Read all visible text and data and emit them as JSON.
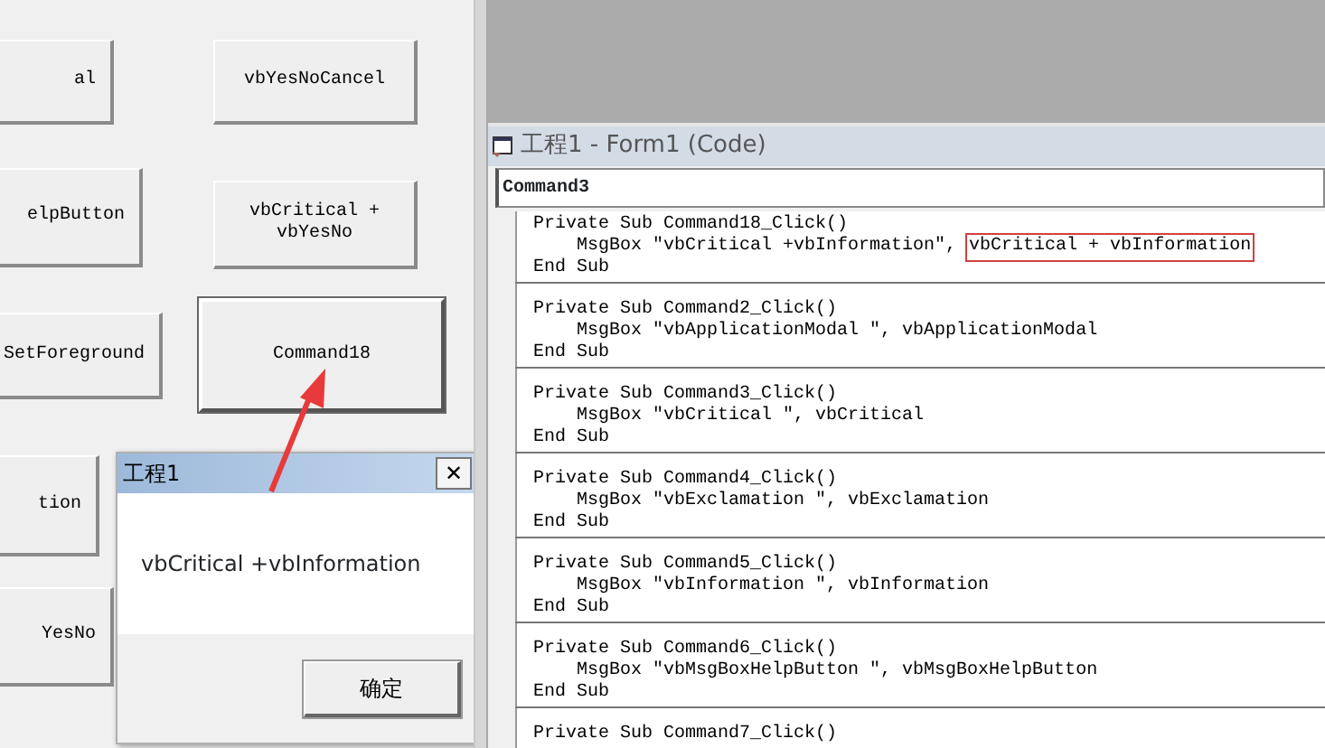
{
  "form_buttons": [
    {
      "label": "al",
      "selected": false
    },
    {
      "label": "vbYesNoCancel",
      "selected": false
    },
    {
      "label": "elpButton",
      "selected": false
    },
    {
      "label": "vbCritical +\nvbYesNo",
      "selected": false
    },
    {
      "label": "SetForeground",
      "selected": false
    },
    {
      "label": "Command18",
      "selected": true
    },
    {
      "label": "tion",
      "selected": false
    },
    {
      "label": "YesNo",
      "selected": false
    }
  ],
  "dialog": {
    "title": "工程1",
    "close": "✕",
    "message": "vbCritical +vbInformation",
    "button": "确定"
  },
  "code_window": {
    "title": "工程1 - Form1 (Code)",
    "object": "Command3",
    "procedures": [
      {
        "sub": "Private Sub Command18_Click()",
        "call": "    MsgBox \"vbCritical +vbInformation\", ",
        "arg": "vbCritical + vbInformation",
        "boxed": true,
        "end": "End Sub"
      },
      {
        "sub": "Private Sub Command2_Click()",
        "call": "    MsgBox \"vbApplicationModal \", ",
        "arg": "vbApplicationModal",
        "boxed": false,
        "end": "End Sub"
      },
      {
        "sub": "Private Sub Command3_Click()",
        "call": "    MsgBox \"vbCritical \", ",
        "arg": "vbCritical",
        "boxed": false,
        "end": "End Sub"
      },
      {
        "sub": "Private Sub Command4_Click()",
        "call": "    MsgBox \"vbExclamation \", ",
        "arg": "vbExclamation",
        "boxed": false,
        "end": "End Sub"
      },
      {
        "sub": "Private Sub Command5_Click()",
        "call": "    MsgBox \"vbInformation \", ",
        "arg": "vbInformation",
        "boxed": false,
        "end": "End Sub"
      },
      {
        "sub": "Private Sub Command6_Click()",
        "call": "    MsgBox \"vbMsgBoxHelpButton \", ",
        "arg": "vbMsgBoxHelpButton",
        "boxed": false,
        "end": "End Sub"
      },
      {
        "sub": "Private Sub Command7_Click()"
      }
    ]
  }
}
